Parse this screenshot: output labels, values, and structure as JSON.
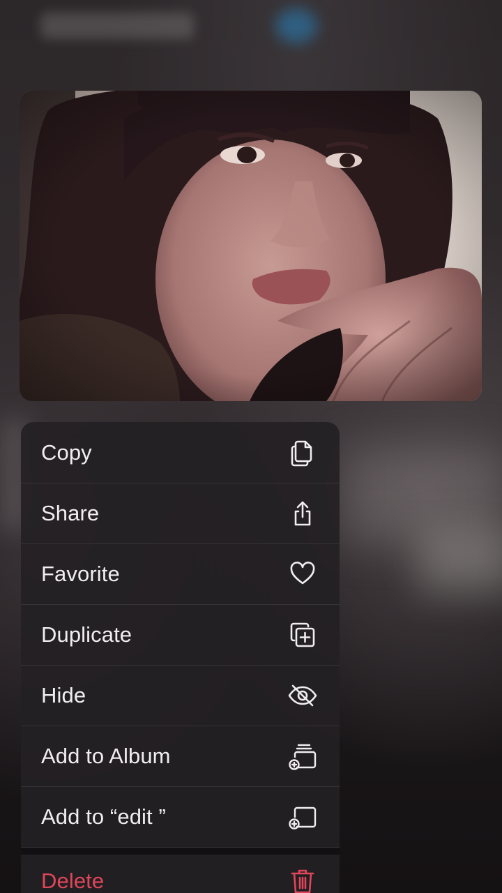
{
  "context_menu": {
    "items": [
      {
        "label": "Copy",
        "icon": "copy-icon",
        "destructive": false
      },
      {
        "label": "Share",
        "icon": "share-icon",
        "destructive": false
      },
      {
        "label": "Favorite",
        "icon": "heart-icon",
        "destructive": false
      },
      {
        "label": "Duplicate",
        "icon": "duplicate-icon",
        "destructive": false
      },
      {
        "label": "Hide",
        "icon": "eye-slash-icon",
        "destructive": false
      },
      {
        "label": "Add to Album",
        "icon": "add-to-album-icon",
        "destructive": false
      },
      {
        "label": "Add to “edit ”",
        "icon": "add-to-folder-icon",
        "destructive": false
      },
      {
        "label": "Delete",
        "icon": "trash-icon",
        "destructive": true
      }
    ]
  },
  "colors": {
    "menu_background": "#242024",
    "label_color": "#f2eeef",
    "destructive_color": "#e0465a"
  }
}
